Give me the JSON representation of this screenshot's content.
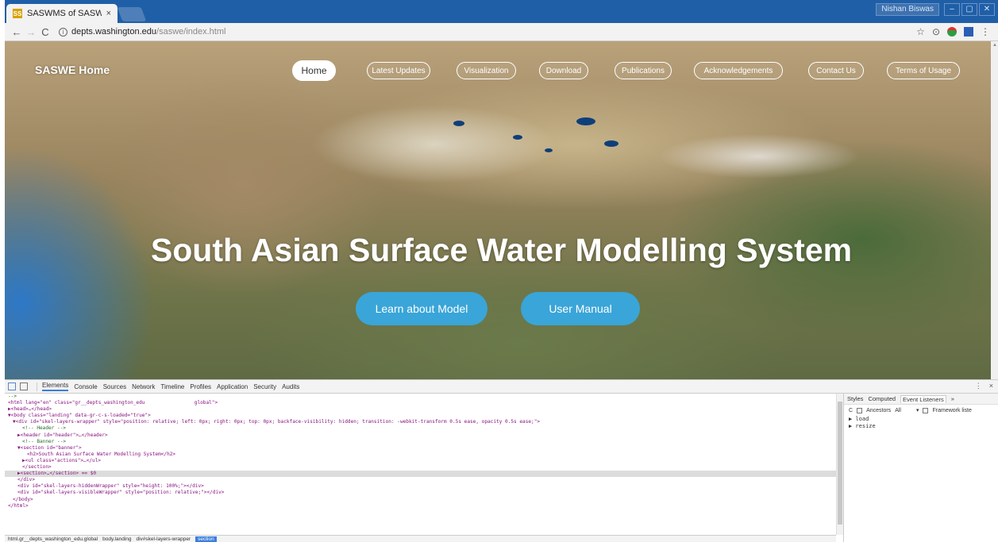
{
  "browser": {
    "tab_title": "SASWMS of SASWE",
    "tab_favicon": "SS",
    "tab_close": "×",
    "user_label": "Nishan Biswas",
    "window_controls": [
      "–",
      "▢",
      "✕"
    ],
    "url_host": "depts.washington.edu",
    "url_path": "/saswe/index.html",
    "back_icon": "←",
    "forward_icon": "→",
    "reload_icon": "C",
    "info_icon": "i",
    "toolbar_icons": {
      "star": "☆",
      "camera": "⊙",
      "menu": "⋮"
    }
  },
  "site": {
    "brand": "SASWE Home",
    "nav": [
      {
        "label": "Home",
        "active": true
      },
      {
        "label": "Latest Updates",
        "active": false
      },
      {
        "label": "Visualization",
        "active": false
      },
      {
        "label": "Download",
        "active": false
      },
      {
        "label": "Publications",
        "active": false
      },
      {
        "label": "Acknowledgements",
        "active": false
      },
      {
        "label": "Contact Us",
        "active": false
      },
      {
        "label": "Terms of Usage",
        "active": false
      }
    ],
    "hero_title": "South Asian Surface Water Modelling System",
    "buttons": [
      "Learn about Model",
      "User Manual"
    ]
  },
  "devtools": {
    "tabs": [
      "Elements",
      "Console",
      "Sources",
      "Network",
      "Timeline",
      "Profiles",
      "Application",
      "Security",
      "Audits"
    ],
    "active_tab": "Elements",
    "right_controls": [
      "⋮",
      "×"
    ],
    "dom_lines": [
      {
        "indent": 0,
        "text": "-->",
        "kind": "cm"
      },
      {
        "indent": 0,
        "text": "<html lang=\"en\" class=\"gr__depts_washington_edu                 global\">",
        "kind": "tag"
      },
      {
        "indent": 0,
        "text": "▶<head>…</head>",
        "kind": "tag"
      },
      {
        "indent": 0,
        "text": "▼<body class=\"landing\" data-gr-c-s-loaded=\"true\">",
        "kind": "tag"
      },
      {
        "indent": 1,
        "text": "▼<div id=\"skel-layers-wrapper\" style=\"position: relative; left: 0px; right: 0px; top: 0px; backface-visibility: hidden; transition: -webkit-transform 0.5s ease, opacity 0.5s ease;\">",
        "kind": "tag"
      },
      {
        "indent": 3,
        "text": "<!-- Header -->",
        "kind": "cm"
      },
      {
        "indent": 2,
        "text": "▶<header id=\"header\">…</header>",
        "kind": "tag"
      },
      {
        "indent": 3,
        "text": "<!-- Banner -->",
        "kind": "cm"
      },
      {
        "indent": 2,
        "text": "▼<section id=\"banner\">",
        "kind": "tag"
      },
      {
        "indent": 4,
        "text": "<h2>South Asian Surface Water Modelling System</h2>",
        "kind": "tag"
      },
      {
        "indent": 3,
        "text": "▶<ul class=\"actions\">…</ul>",
        "kind": "tag"
      },
      {
        "indent": 3,
        "text": "</section>",
        "kind": "tag"
      },
      {
        "indent": 2,
        "text": "▶<section>…</section> == $0",
        "kind": "sel"
      },
      {
        "indent": 2,
        "text": "</div>",
        "kind": "tag"
      },
      {
        "indent": 2,
        "text": "<div id=\"skel-layers-hiddenWrapper\" style=\"height: 100%;\"></div>",
        "kind": "tag"
      },
      {
        "indent": 2,
        "text": "<div id=\"skel-layers-visibleWrapper\" style=\"position: relative;\"></div>",
        "kind": "tag"
      },
      {
        "indent": 1,
        "text": "</body>",
        "kind": "tag"
      },
      {
        "indent": 0,
        "text": "</html>",
        "kind": "tag"
      }
    ],
    "side_tabs": [
      "Styles",
      "Computed",
      "Event Listeners",
      "»"
    ],
    "side_active": "Event Listeners",
    "side_filter": {
      "refresh": "C",
      "ancestors": "Ancestors",
      "all": "All",
      "framework": "Framework liste"
    },
    "listeners": [
      "▶ load",
      "▶ resize"
    ],
    "breadcrumbs": [
      "html.gr__depts_washington_edu.global",
      "body.landing",
      "div#skel-layers-wrapper",
      "section"
    ]
  },
  "colors": {
    "accent": "#3aa5d8",
    "chrome_title": "#1f5fa8",
    "selection": "#3b7ddd"
  }
}
